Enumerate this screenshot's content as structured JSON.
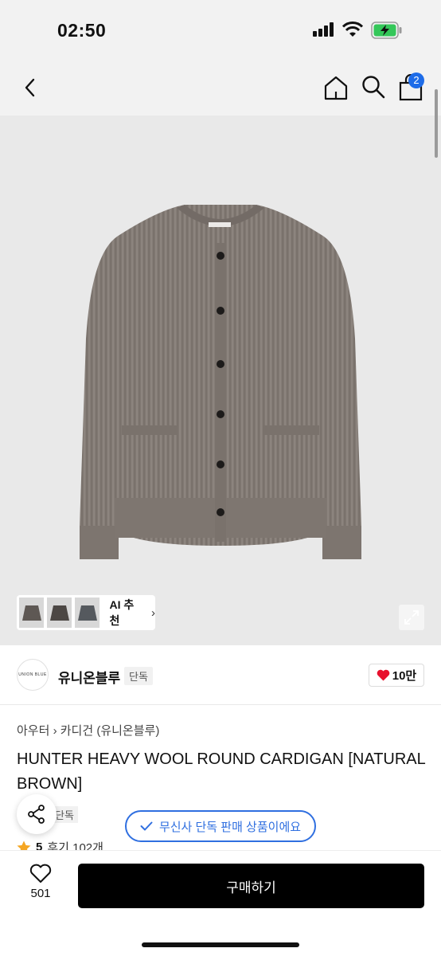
{
  "status_bar": {
    "time": "02:50"
  },
  "header": {
    "cart_badge": "2"
  },
  "gallery": {
    "ai_label": "AI 추천",
    "ai_chevron": "›"
  },
  "brand": {
    "logo_text": "UNION BLUE",
    "name": "유니온블루",
    "exclusive_tag": "단독",
    "likes": "10만"
  },
  "breadcrumb": {
    "level1": "아우터",
    "separator": "›",
    "level2": "카디건 (유니온블루)"
  },
  "product": {
    "title": "HUNTER HEAVY WOOL ROUND CARDIGAN [NATURAL BROWN]",
    "exclusive_tag": "단독",
    "rating": "5",
    "reviews": "후기 102개"
  },
  "toast": {
    "text": "무신사 단독 판매 상품이에요"
  },
  "bottom_bar": {
    "wish_count": "501",
    "buy_label": "구매하기"
  },
  "colors": {
    "accent_blue": "#2f6fe0",
    "badge_blue": "#1e6ce8",
    "heart_red": "#e8112d",
    "star": "#f5a623",
    "cardigan": "#857d77"
  }
}
